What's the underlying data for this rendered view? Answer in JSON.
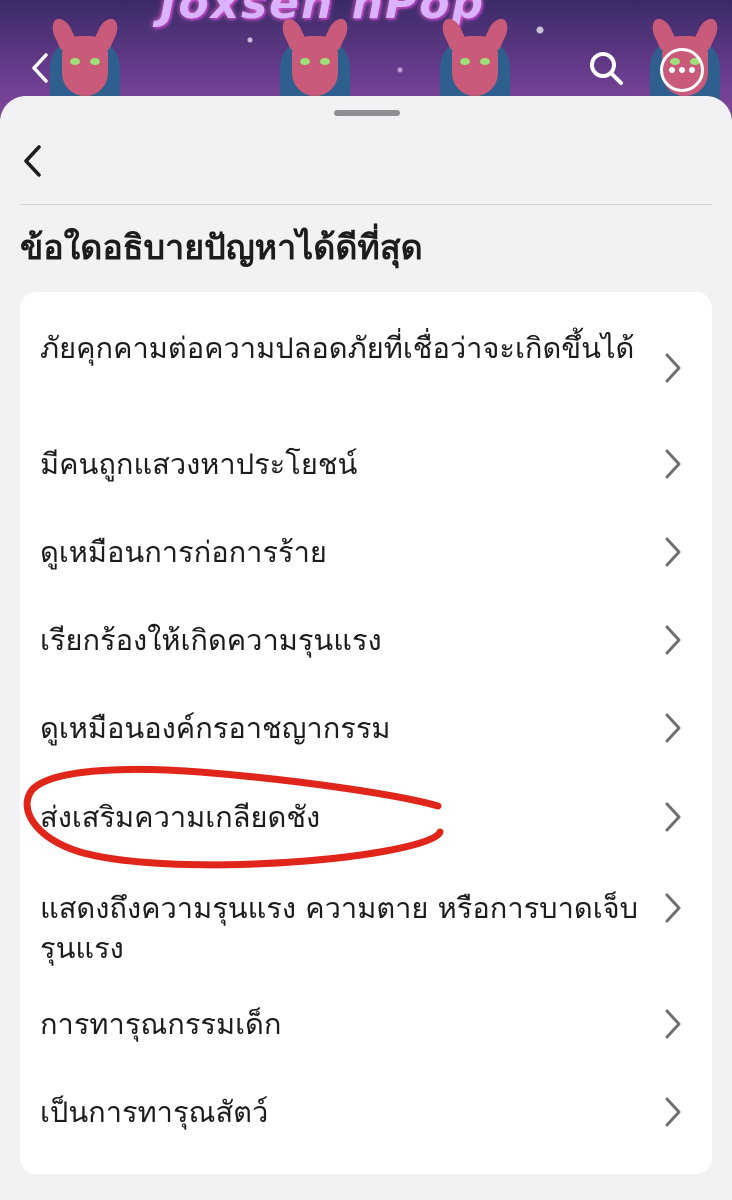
{
  "cover": {
    "title": "Joxsen hPop"
  },
  "sheet": {
    "heading": "ข้อใดอธิบายปัญหาได้ดีที่สุด"
  },
  "options": [
    {
      "label": "ภัยคุกคามต่อความปลอดภัยที่เชื่อว่าจะเกิดขึ้นได้"
    },
    {
      "label": "มีคนถูกแสวงหาประโยชน์"
    },
    {
      "label": "ดูเหมือนการก่อการร้าย"
    },
    {
      "label": "เรียกร้องให้เกิดความรุนแรง"
    },
    {
      "label": "ดูเหมือนองค์กรอาชญากรรม"
    },
    {
      "label": "ส่งเสริมความเกลียดชัง"
    },
    {
      "label": "แสดงถึงความรุนแรง ความตาย หรือการบาดเจ็บรุนแรง"
    },
    {
      "label": "การทารุณกรรมเด็ก"
    },
    {
      "label": "เป็นการทารุณสัตว์"
    }
  ],
  "colors": {
    "annotation": "#e0261b",
    "chevron": "#6e6e73"
  },
  "icons": [
    "back-chevron-icon",
    "search-icon",
    "more-icon",
    "chevron-right-icon"
  ]
}
